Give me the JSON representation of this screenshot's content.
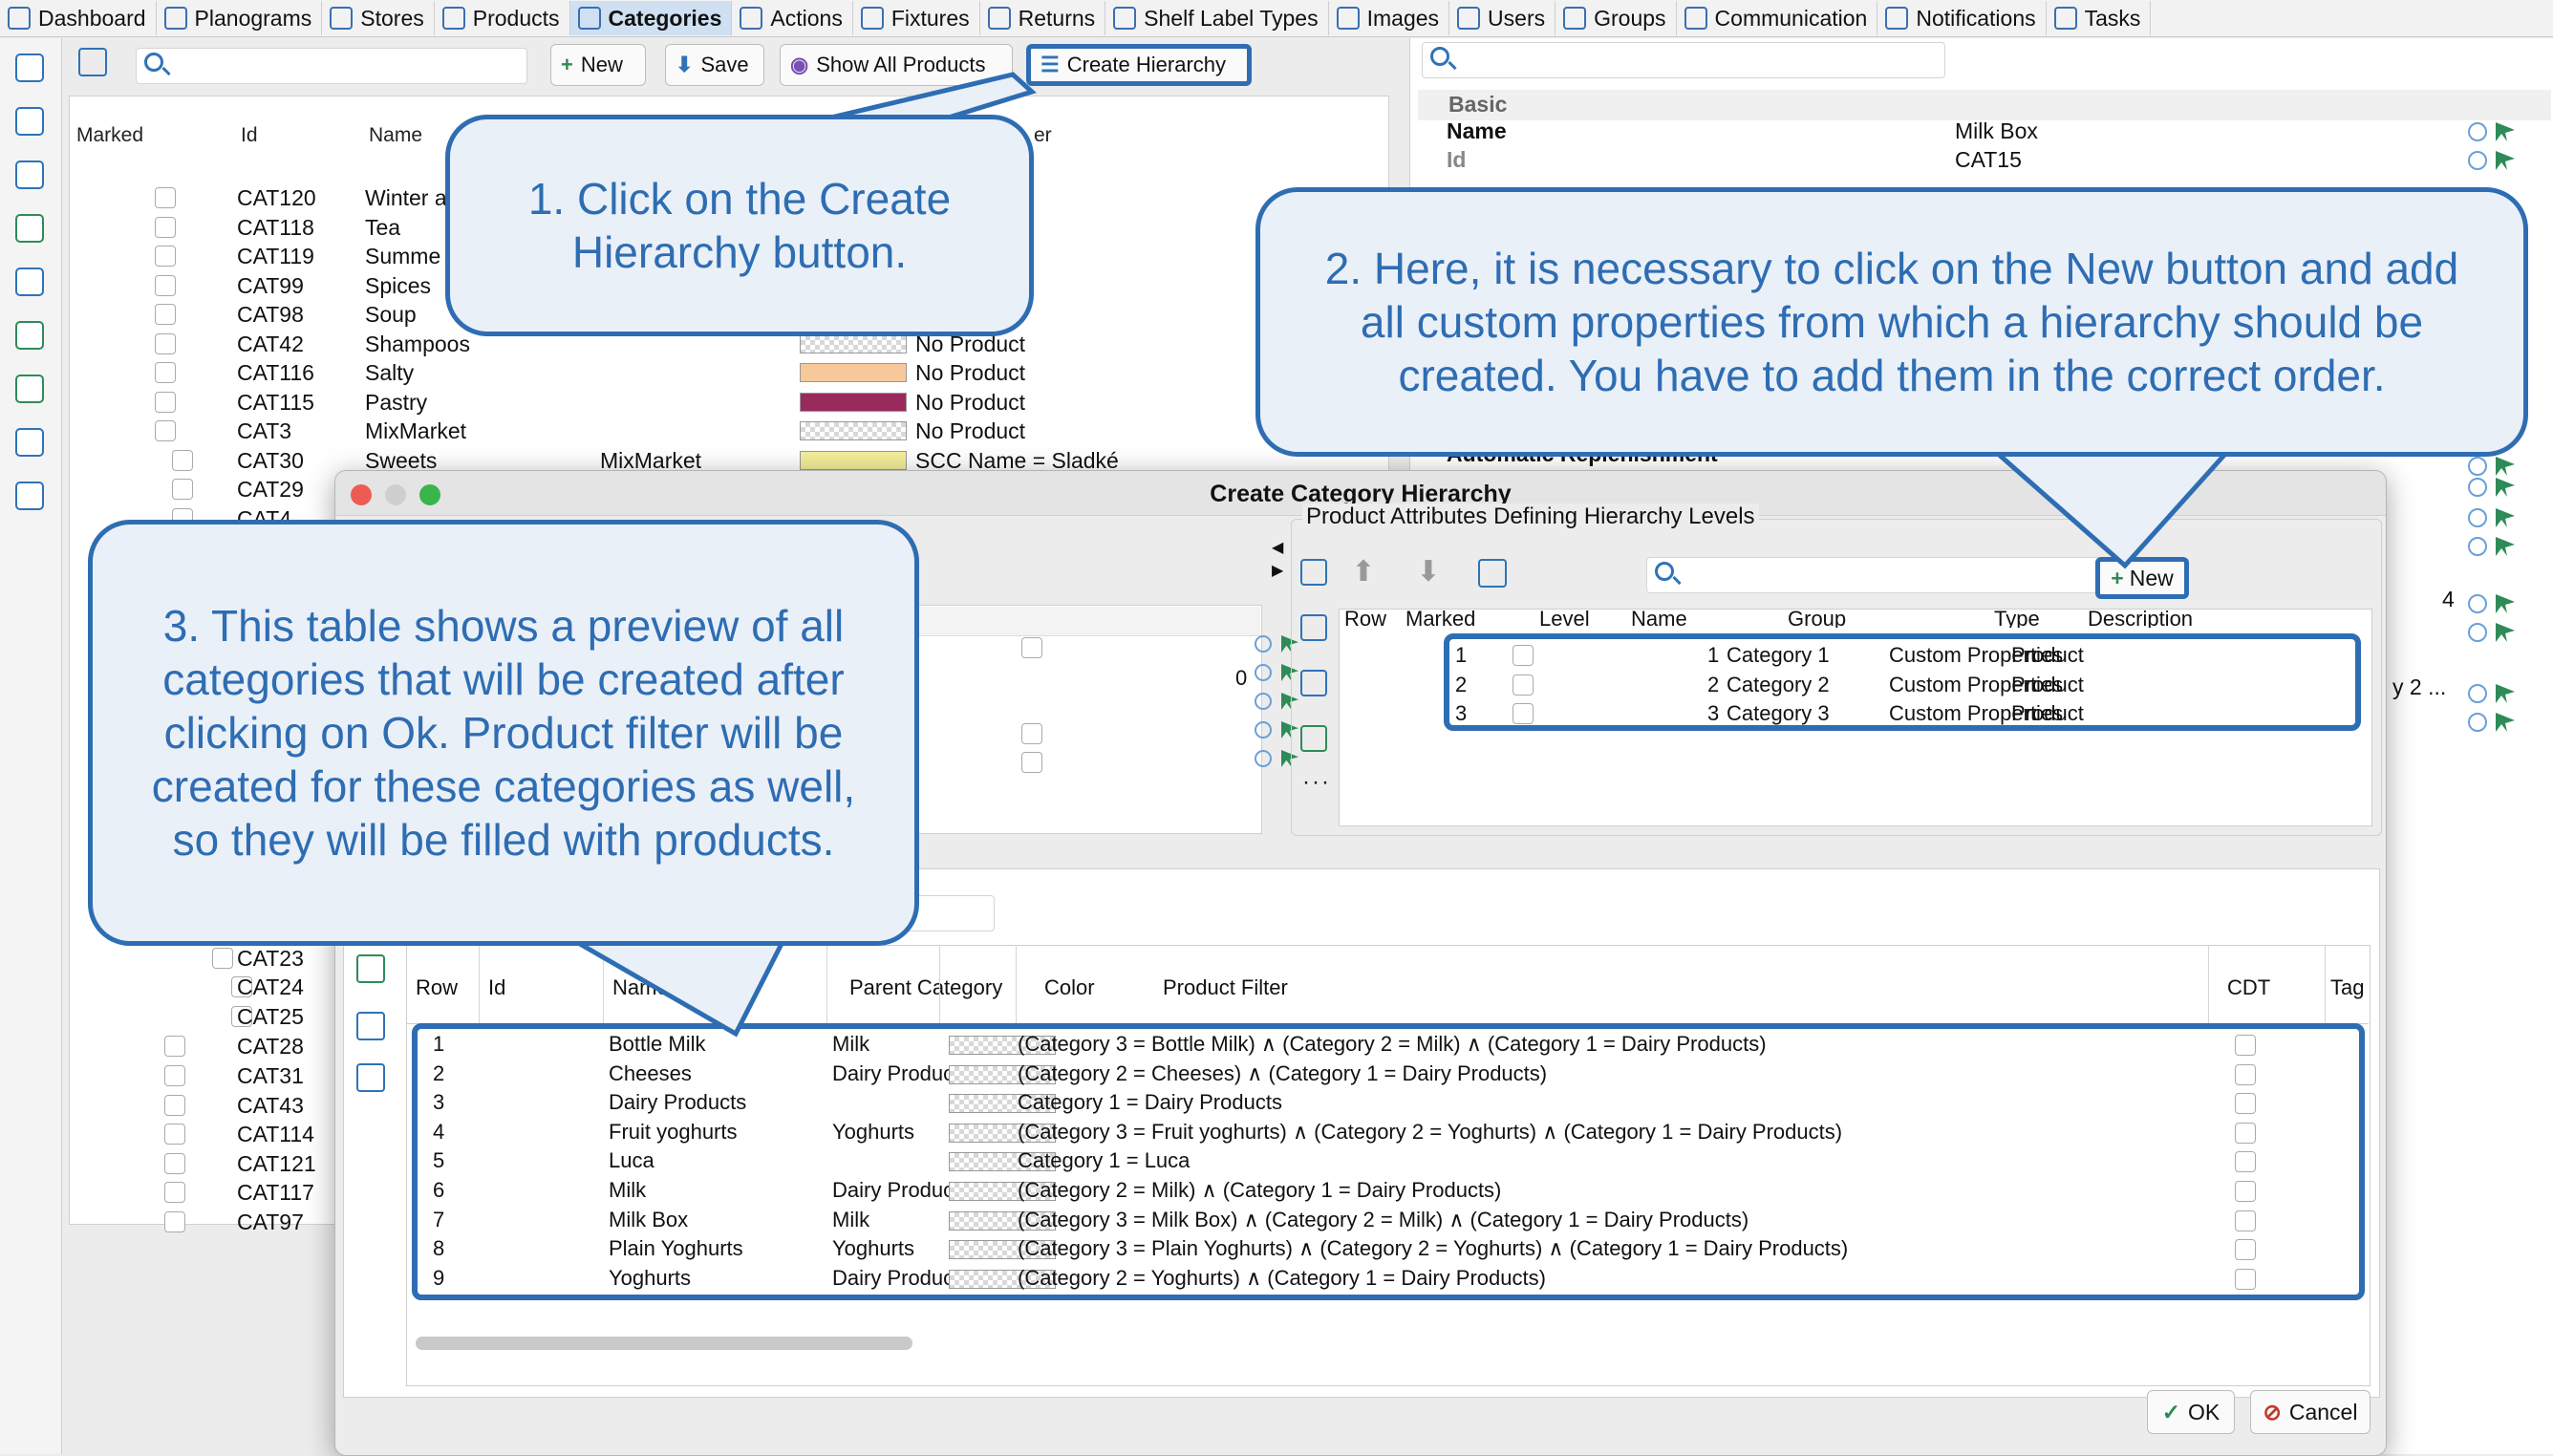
{
  "nav": {
    "tabs": [
      {
        "label": "Dashboard",
        "icon": "dashboard-icon"
      },
      {
        "label": "Planograms",
        "icon": "planogram-icon"
      },
      {
        "label": "Stores",
        "icon": "store-cart-icon"
      },
      {
        "label": "Products",
        "icon": "product-box-icon"
      },
      {
        "label": "Categories",
        "icon": "category-icon",
        "active": true
      },
      {
        "label": "Actions",
        "icon": "action-clock-icon"
      },
      {
        "label": "Fixtures",
        "icon": "fixture-icon"
      },
      {
        "label": "Returns",
        "icon": "return-icon"
      },
      {
        "label": "Shelf Label Types",
        "icon": "label-tag-icon"
      },
      {
        "label": "Images",
        "icon": "image-icon"
      },
      {
        "label": "Users",
        "icon": "user-icon"
      },
      {
        "label": "Groups",
        "icon": "group-icon"
      },
      {
        "label": "Communication",
        "icon": "mail-icon"
      },
      {
        "label": "Notifications",
        "icon": "bell-icon"
      },
      {
        "label": "Tasks",
        "icon": "task-check-icon"
      }
    ]
  },
  "toolbar": {
    "new_label": "New",
    "save_label": "Save",
    "show_all_label": "Show All Products",
    "create_hierarchy_label": "Create Hierarchy"
  },
  "list": {
    "headers": {
      "marked": "Marked",
      "id": "Id",
      "name": "Name",
      "filter_partial": "er"
    },
    "rows": [
      {
        "id": "CAT120",
        "name": "Winter a",
        "parent": "",
        "color": "",
        "filter": ""
      },
      {
        "id": "CAT118",
        "name": "Tea",
        "parent": "",
        "color": "",
        "filter": ""
      },
      {
        "id": "CAT119",
        "name": "Summe",
        "parent": "",
        "color": "",
        "filter": ""
      },
      {
        "id": "CAT99",
        "name": "Spices",
        "parent": "",
        "color": "",
        "filter": ""
      },
      {
        "id": "CAT98",
        "name": "Soup",
        "parent": "",
        "color": "",
        "filter": ""
      },
      {
        "id": "CAT42",
        "name": "Shampoos",
        "parent": "",
        "color": "#e8e8e8",
        "filter": "No Product"
      },
      {
        "id": "CAT116",
        "name": "Salty",
        "parent": "",
        "color": "#f7c99a",
        "filter": "No Product"
      },
      {
        "id": "CAT115",
        "name": "Pastry",
        "parent": "",
        "color": "#9b2a5c",
        "filter": "No Product"
      },
      {
        "id": "CAT3",
        "name": "MixMarket",
        "parent": "",
        "color": "#e8e8e8",
        "filter": "No Product"
      },
      {
        "id": "CAT30",
        "name": "Sweets",
        "parent": "MixMarket",
        "color": "#f3ee9a",
        "filter": "SCC Name = Sladké"
      },
      {
        "id": "CAT29",
        "name": "",
        "parent": "",
        "color": "",
        "filter": ""
      },
      {
        "id": "CAT4",
        "name": "",
        "parent": "",
        "color": "",
        "filter": ""
      }
    ],
    "lower_rows": [
      "CAT23",
      "CAT24",
      "CAT25",
      "CAT28",
      "CAT31",
      "CAT43",
      "CAT114",
      "CAT121",
      "CAT117",
      "CAT97"
    ]
  },
  "properties": {
    "section": "Basic",
    "name_label": "Name",
    "name_value": "Milk Box",
    "id_label": "Id",
    "id_value": "CAT15",
    "partial_row": "Automatic Replenishment",
    "value_4": "4",
    "partial_value": "y 2 ..."
  },
  "dialog": {
    "title": "Create Category Hierarchy",
    "attributes_caption": "Product Attributes Defining Hierarchy Levels",
    "new_label": "New",
    "attr_headers": {
      "row": "Row",
      "marked": "Marked",
      "level": "Level",
      "name": "Name",
      "group": "Group",
      "type": "Type",
      "description": "Description"
    },
    "attr_rows": [
      {
        "row": "1",
        "level": "1",
        "name": "Category 1",
        "group": "Custom Properties",
        "type": "Product"
      },
      {
        "row": "2",
        "level": "2",
        "name": "Category 2",
        "group": "Custom Properties",
        "type": "Product"
      },
      {
        "row": "3",
        "level": "3",
        "name": "Category 3",
        "group": "Custom Properties",
        "type": "Product"
      }
    ],
    "left_value": "0",
    "preview_headers": {
      "row": "Row",
      "id": "Id",
      "name": "Name",
      "parent": "Parent Category",
      "color": "Color",
      "filter": "Product Filter",
      "cdt": "CDT",
      "tag": "Tag"
    },
    "preview_rows": [
      {
        "row": "1",
        "name": "Bottle Milk",
        "parent": "Milk",
        "filter": "(Category 3 = Bottle Milk) ∧ (Category 2 = Milk) ∧ (Category 1 = Dairy Products)"
      },
      {
        "row": "2",
        "name": "Cheeses",
        "parent": "Dairy Products",
        "filter": "(Category 2 = Cheeses) ∧ (Category 1 = Dairy Products)"
      },
      {
        "row": "3",
        "name": "Dairy Products",
        "parent": "",
        "filter": "Category 1 = Dairy Products"
      },
      {
        "row": "4",
        "name": "Fruit yoghurts",
        "parent": "Yoghurts",
        "filter": "(Category 3 = Fruit yoghurts) ∧ (Category 2 = Yoghurts) ∧ (Category 1 = Dairy Products)"
      },
      {
        "row": "5",
        "name": "Luca",
        "parent": "",
        "filter": "Category 1 = Luca"
      },
      {
        "row": "6",
        "name": "Milk",
        "parent": "Dairy Products",
        "filter": "(Category 2 = Milk) ∧ (Category 1 = Dairy Products)"
      },
      {
        "row": "7",
        "name": "Milk Box",
        "parent": "Milk",
        "filter": "(Category 3 = Milk Box) ∧ (Category 2 = Milk) ∧ (Category 1 = Dairy Products)"
      },
      {
        "row": "8",
        "name": "Plain Yoghurts",
        "parent": "Yoghurts",
        "filter": "(Category 3 = Plain Yoghurts) ∧ (Category 2 = Yoghurts) ∧ (Category 1 = Dairy Products)"
      },
      {
        "row": "9",
        "name": "Yoghurts",
        "parent": "Dairy Products",
        "filter": "(Category 2 = Yoghurts) ∧ (Category 1 = Dairy Products)"
      }
    ],
    "ok_label": "OK",
    "cancel_label": "Cancel"
  },
  "callouts": {
    "c1": "1. Click on the Create Hierarchy button.",
    "c2": "2. Here, it is necessary to click on the New button and add all custom properties from which a hierarchy should be created. You have to add them in the correct order.",
    "c3": "3. This table shows a preview of all categories that will be created after clicking on Ok. Product filter will be created for these categories as well, so they will be filled with products."
  },
  "colors": {
    "accent": "#2e6db3",
    "callout_bg": "#eaf0f7"
  }
}
